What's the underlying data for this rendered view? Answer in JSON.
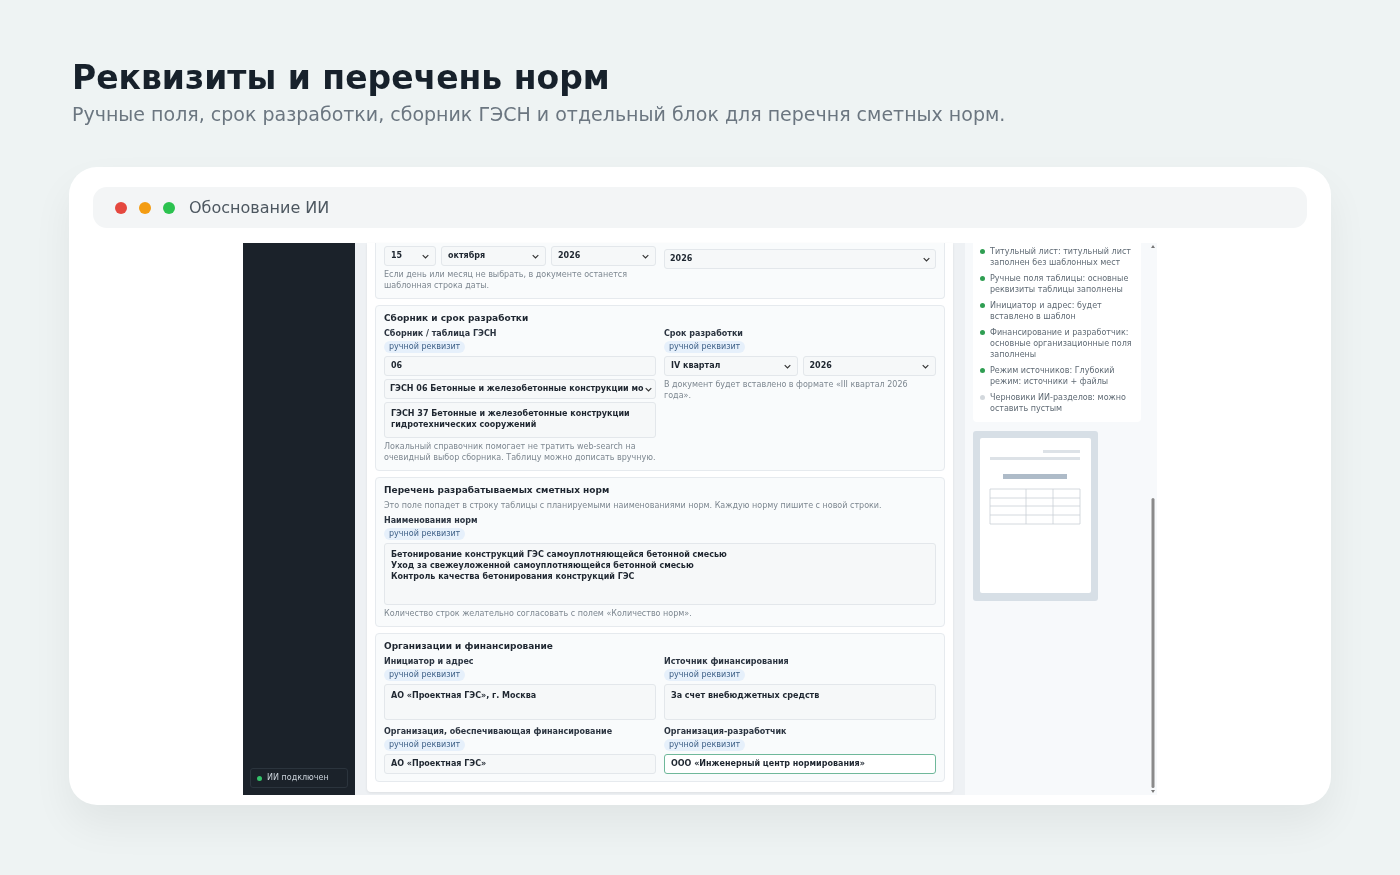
{
  "heading": {
    "title": "Реквизиты и перечень норм",
    "subtitle": "Ручные поля, срок разработки, сборник ГЭСН и отдельный блок для перечня сметных норм."
  },
  "window": {
    "title": "Обоснование ИИ"
  },
  "sidebar": {
    "status": {
      "label": "ИИ подключен",
      "on": true
    }
  },
  "sections": [
    {
      "columns": [
        [
          {
            "kind": "select_row",
            "options": [
              "15",
              "октября",
              "2026"
            ]
          },
          {
            "kind": "hint",
            "text": "Если день или месяц не выбрать, в документе останется шаблонная строка даты."
          }
        ],
        [
          {
            "kind": "select",
            "value": "2026"
          }
        ]
      ]
    },
    {
      "title": "Сборник и срок разработки",
      "columns": [
        [
          {
            "kind": "label",
            "text": "Сборник / таблица ГЭСН"
          },
          {
            "kind": "badge",
            "text": "ручной реквизит"
          },
          {
            "kind": "input",
            "value": "06",
            "focused": false
          },
          {
            "kind": "select",
            "value": "ГЭСН 06 Бетонные и железобетонные конструкции мо"
          },
          {
            "kind": "textarea",
            "value": "ГЭСН 37 Бетонные и железобетонные конструкции гидротехнических сооружений"
          },
          {
            "kind": "hint",
            "text": "Локальный справочник помогает не тратить web-search на очевидный выбор сборника. Таблицу можно дописать вручную."
          }
        ],
        [
          {
            "kind": "label",
            "text": "Срок разработки"
          },
          {
            "kind": "badge",
            "text": "ручной реквизит"
          },
          {
            "kind": "select_row",
            "options": [
              "IV квартал",
              "2026"
            ]
          },
          {
            "kind": "hint",
            "text": "В документ будет вставлено в формате «III квартал 2026 года»."
          }
        ]
      ]
    },
    {
      "title": "Перечень разрабатываемых сметных норм",
      "description": "Это поле попадет в строку таблицы с планируемыми наименованиями норм. Каждую норму пишите с новой строки.",
      "columns": [
        [
          {
            "kind": "label",
            "text": "Наименования норм"
          },
          {
            "kind": "badge",
            "text": "ручной реквизит"
          },
          {
            "kind": "textarea",
            "lines": [
              "Бетонирование конструкций ГЭС самоуплотняющейся бетонной смесью",
              "Уход за свежеуложенной самоуплотняющейся бетонной смесью",
              "Контроль качества бетонирования конструкций ГЭС"
            ]
          },
          {
            "kind": "hint",
            "text": "Количество строк желательно согласовать с полем «Количество норм»."
          }
        ]
      ]
    },
    {
      "title": "Организации и финансирование",
      "columns": [
        [
          {
            "kind": "label",
            "text": "Инициатор и адрес"
          },
          {
            "kind": "badge",
            "text": "ручной реквизит"
          },
          {
            "kind": "textarea",
            "value": "АО «Проектная ГЭС», г. Москва"
          },
          {
            "kind": "label",
            "text": "Организация, обеспечивающая финансирование"
          },
          {
            "kind": "badge",
            "text": "ручной реквизит"
          },
          {
            "kind": "input",
            "value": "АО «Проектная ГЭС»",
            "focused": false
          }
        ],
        [
          {
            "kind": "label",
            "text": "Источник финансирования"
          },
          {
            "kind": "badge",
            "text": "ручной реквизит"
          },
          {
            "kind": "textarea",
            "value": "За счет внебюджетных средств"
          },
          {
            "kind": "label",
            "text": "Организация-разработчик"
          },
          {
            "kind": "badge",
            "text": "ручной реквизит"
          },
          {
            "kind": "input",
            "value": "ООО «Инженерный центр нормирования»",
            "focused": true
          }
        ]
      ]
    }
  ],
  "checklist": [
    {
      "text": "Титульный лист: титульный лист заполнен без шаблонных мест",
      "done": true
    },
    {
      "text": "Ручные поля таблицы: основные реквизиты таблицы заполнены",
      "done": true
    },
    {
      "text": "Инициатор и адрес: будет вставлено в шаблон",
      "done": true
    },
    {
      "text": "Финансирование и разработчик: основные организационные поля заполнены",
      "done": true
    },
    {
      "text": "Режим источников: Глубокий режим: источники + файлы",
      "done": true
    },
    {
      "text": "Черновики ИИ-разделов: можно оставить пустым",
      "done": false
    }
  ]
}
